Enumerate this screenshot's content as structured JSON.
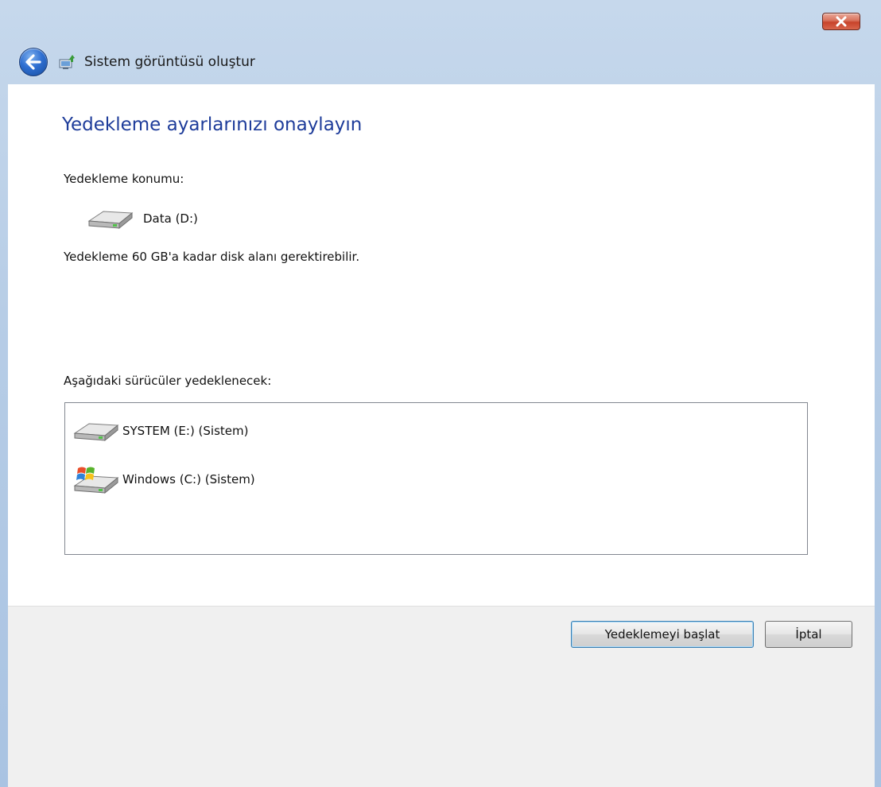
{
  "window": {
    "nav_title": "Sistem görüntüsü oluştur"
  },
  "content": {
    "heading": "Yedekleme ayarlarınızı onaylayın",
    "location_label": "Yedekleme konumu:",
    "location_drive": {
      "label": "Data (D:)",
      "icon": "hard-drive-icon"
    },
    "space_notice": "Yedekleme 60 GB'a kadar disk alanı gerektirebilir.",
    "drives_list_label": "Aşağıdaki sürücüler yedeklenecek:",
    "drives": [
      {
        "label": "SYSTEM (E:) (Sistem)",
        "icon": "hard-drive-icon"
      },
      {
        "label": "Windows (C:) (Sistem)",
        "icon": "windows-drive-icon"
      }
    ]
  },
  "footer": {
    "start_button": "Yedeklemeyi başlat",
    "cancel_button": "İptal"
  },
  "colors": {
    "heading": "#1e3c9a",
    "frame": "#b7cde6",
    "footer": "#f0f0f0"
  }
}
